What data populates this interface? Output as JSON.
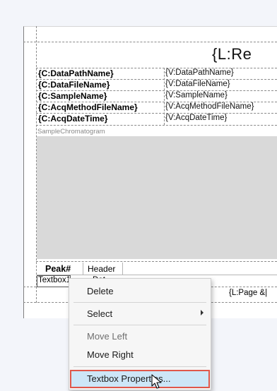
{
  "report": {
    "title": "{L:Re",
    "fields": [
      {
        "key": "{C:DataPathName}",
        "value": "{V:DataPathName}"
      },
      {
        "key": "{C:DataFileName}",
        "value": "{V:DataFileName}"
      },
      {
        "key": "{C:SampleName}",
        "value": "{V:SampleName}"
      },
      {
        "key": "{C:AcqMethodFileName}",
        "value": "{V:AcqMethodFileName}"
      },
      {
        "key": "{C:AcqDateTime}",
        "value": "{V:AcqDateTime}"
      }
    ],
    "chromatogram_label": "SampleChromatogram",
    "table": {
      "header_peak": "Peak#",
      "header_col": "Header",
      "textbox": "Textbox1",
      "partial_cell": "Dat",
      "page_footer": "{L:Page &|"
    }
  },
  "context_menu": {
    "items": [
      {
        "label": "Delete",
        "enabled": true
      },
      {
        "label": "Select",
        "enabled": true,
        "submenu": true
      },
      {
        "label": "Move Left",
        "enabled": false
      },
      {
        "label": "Move Right",
        "enabled": true
      },
      {
        "label": "Textbox Properties...",
        "enabled": true,
        "highlighted": true
      }
    ]
  },
  "colors": {
    "chromatogram_bg": "#d9d9d9",
    "highlight_bg": "#cde6f7",
    "highlight_border": "#e0574a",
    "menu_bg": "#f6f6f6"
  }
}
